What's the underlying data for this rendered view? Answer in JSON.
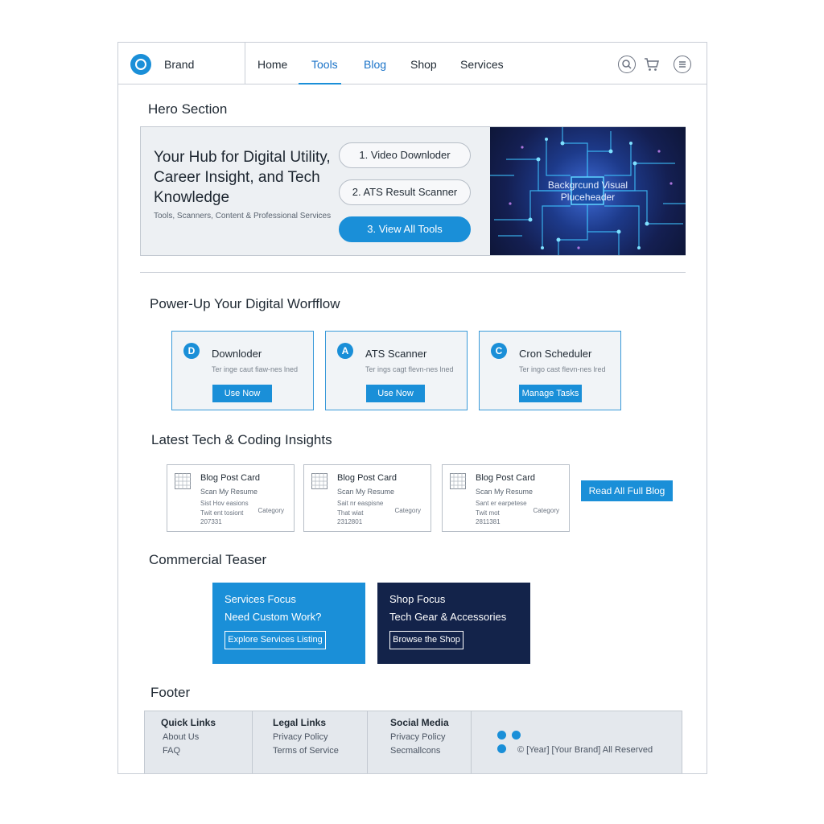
{
  "header": {
    "brand": "Brand",
    "nav": [
      "Home",
      "Tools",
      "Blog",
      "Shop",
      "Services"
    ],
    "icons": [
      "search-icon",
      "cart-icon",
      "menu-icon"
    ]
  },
  "hero": {
    "section_title": "Hero Section",
    "heading": "Your Hub for Digital Utility, Career Insight, and Tech Knowledge",
    "subheading": "Tools, Scanners, Content & Professional Services",
    "buttons": [
      "1. Video Downloder",
      "2. ATS Result Scanner",
      "3. View All Tools"
    ],
    "visual_label_1": "Backgrcund Visual",
    "visual_label_2": "Pluceheader"
  },
  "workflow": {
    "section_title": "Power-Up Your Digital Worfflow",
    "cards": [
      {
        "badge": "D",
        "title": "Downloder",
        "desc": "Ter inge caut fiaw-nes lned",
        "button": "Use Now"
      },
      {
        "badge": "A",
        "title": "ATS Scanner",
        "desc": "Ter ings cagt flevn-nes lned",
        "button": "Use Now"
      },
      {
        "badge": "C",
        "title": "Cron Scheduler",
        "desc": "Ter ingo cast flevn-nes lred",
        "button": "Manage Tasks"
      }
    ]
  },
  "blog": {
    "section_title": "Latest Tech & Coding Insights",
    "cards": [
      {
        "title": "Blog Post Card",
        "subtitle": "Scan My Resume",
        "line1": "Sist Hov easions",
        "line2": "Twit ent tosiont",
        "date": "207331",
        "category": "Category"
      },
      {
        "title": "Blog Post Card",
        "subtitle": "Scan My Resume",
        "line1": "Sait nr easpisne",
        "line2": "That wiat",
        "date": "2312801",
        "category": "Category"
      },
      {
        "title": "Blog Post Card",
        "subtitle": "Scan My Resume",
        "line1": "Sant er earpetese",
        "line2": "Twit mot",
        "date": "2811381",
        "category": "Category"
      }
    ],
    "read_all": "Read All Full Blog"
  },
  "teaser": {
    "section_title": "Commercial Teaser",
    "services": {
      "title": "Services Focus",
      "subtitle": "Need Custom Work?",
      "button": "Explore Services Listing"
    },
    "shop": {
      "title": "Shop Focus",
      "subtitle": "Tech Gear & Accessories",
      "button": "Browse the Shop"
    }
  },
  "footer": {
    "section_title": "Footer",
    "quick_links": {
      "title": "Quick Links",
      "items": [
        "About Us",
        "FAQ"
      ]
    },
    "legal_links": {
      "title": "Legal Links",
      "items": [
        "Privacy Policy",
        "Terms of Service"
      ]
    },
    "social_media": {
      "title": "Social Media",
      "items": [
        "Privacy Policy",
        "Secmallcons"
      ]
    },
    "copyright": "© [Year] [Your Brand] All Reserved"
  },
  "colors": {
    "accent": "#1a8fd8",
    "dark_navy": "#13234a",
    "panel": "#edf0f3"
  }
}
